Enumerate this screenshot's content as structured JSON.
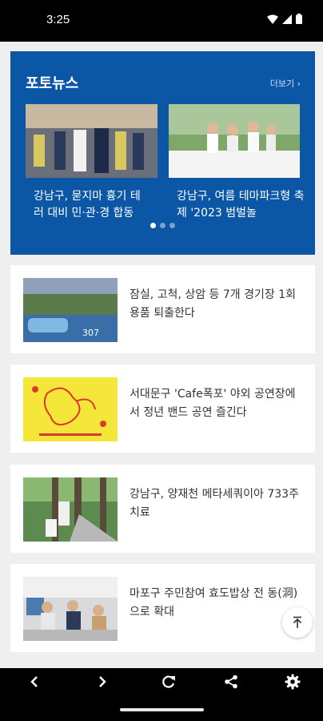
{
  "status": {
    "time": "3:25"
  },
  "photo_news": {
    "title": "포토뉴스",
    "more_label": "더보기",
    "cards": [
      {
        "caption": "강남구, 묻지마 흉기 테러 대비 민·관·경 합동"
      },
      {
        "caption": "강남구, 여름 테마파크형 축제 '2023 범벌놀"
      }
    ],
    "page_count": 3,
    "active_page": 1
  },
  "news": [
    {
      "title": "잠실, 고척, 상암 등 7개 경기장 1회용품 퇴출한다",
      "thumb_label": "307"
    },
    {
      "title": "서대문구 'Cafe폭포' 야외 공연장에서 정년 밴드 공연 즐긴다"
    },
    {
      "title": "강남구, 양재천 메타세쿼이아 733주 치료"
    },
    {
      "title": "마포구 주민참여 효도밥상 전 동(洞)으로 확대"
    }
  ],
  "toolbar": {
    "back_icon": "chevron-left-icon",
    "forward_icon": "chevron-right-icon",
    "refresh_icon": "refresh-icon",
    "share_icon": "share-icon",
    "settings_icon": "gear-icon"
  },
  "colors": {
    "panel": "#0b57a6",
    "background": "#efefef"
  }
}
